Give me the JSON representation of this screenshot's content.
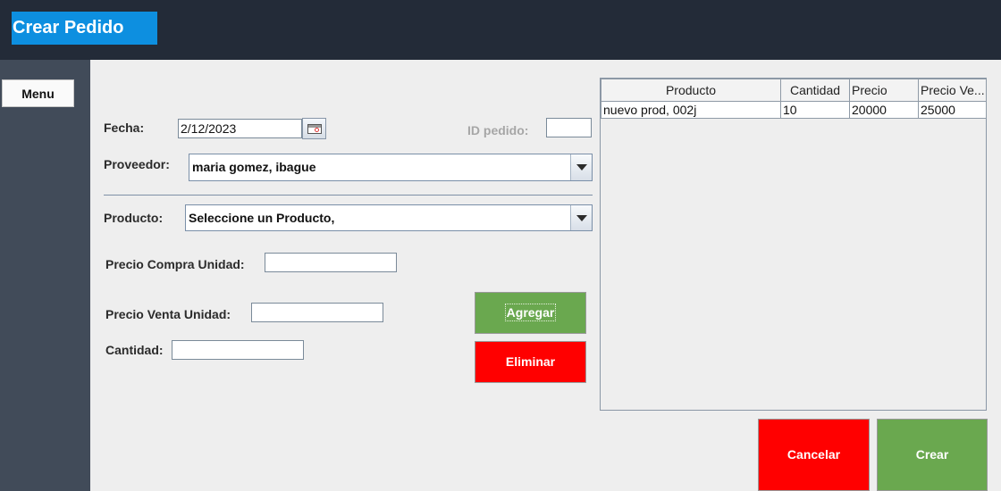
{
  "header": {
    "title": "Crear Pedido"
  },
  "sidebar": {
    "menu_label": "Menu"
  },
  "form": {
    "fecha_label": "Fecha:",
    "fecha_value": "2/12/2023",
    "id_pedido_label": "ID pedido:",
    "id_pedido_value": "",
    "proveedor_label": "Proveedor:",
    "proveedor_value": "maria gomez, ibague",
    "producto_label": "Producto:",
    "producto_value": "Seleccione un Producto,",
    "precio_compra_label": "Precio Compra Unidad:",
    "precio_compra_value": "",
    "precio_venta_label": "Precio Venta Unidad:",
    "precio_venta_value": "",
    "cantidad_label": "Cantidad:",
    "cantidad_value": ""
  },
  "buttons": {
    "agregar": "Agregar",
    "eliminar": "Eliminar",
    "cancelar": "Cancelar",
    "crear": "Crear"
  },
  "table": {
    "headers": [
      "Producto",
      "Cantidad",
      "Precio",
      "Precio Ve..."
    ],
    "rows": [
      [
        "nuevo prod, 002j",
        "10",
        "20000",
        "25000"
      ]
    ]
  },
  "colors": {
    "topbar": "#232b38",
    "title_bg": "#0d8fe0",
    "sidebar": "#414b59",
    "green": "#6aa84f",
    "red": "#ff0000"
  },
  "icons": {
    "calendar": "calendar-icon",
    "dropdown": "chevron-down-icon"
  }
}
